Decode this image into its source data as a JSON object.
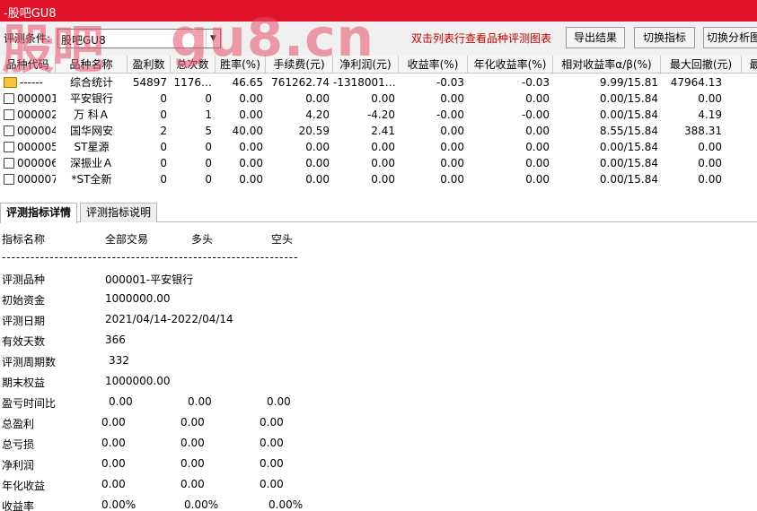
{
  "window": {
    "title": "-股吧GU8"
  },
  "watermark": {
    "left": "股吧",
    "right": "gu8.cn"
  },
  "toolbar": {
    "condition_label": "评测条件:",
    "condition_value": "股吧GU8",
    "hint": "双击列表行查看品种评测图表",
    "export_label": "导出结果",
    "switch_indicator_label": "切换指标",
    "switch_analysis_label": "切换分析图"
  },
  "table": {
    "columns": [
      "品种代码",
      "品种名称",
      "盈利数",
      "总次数",
      "胜率(%)",
      "手续费(元)",
      "净利润(元)",
      "收益率(%)",
      "年化收益率(%)",
      "相对收益率α/β(%)",
      "最大回撤(元)",
      "最"
    ],
    "rows": [
      [
        "------",
        "综合统计",
        "54897",
        "1176…",
        "46.65",
        "761262.74",
        "-1318001…",
        "-0.03",
        "-0.03",
        "9.99/15.81",
        "47964.13"
      ],
      [
        "000001",
        "平安银行",
        "0",
        "0",
        "0.00",
        "0.00",
        "0.00",
        "0.00",
        "0.00",
        "0.00/15.84",
        "0.00"
      ],
      [
        "000002",
        "万 科Ａ",
        "0",
        "1",
        "0.00",
        "4.20",
        "-4.20",
        "-0.00",
        "-0.00",
        "0.00/15.84",
        "4.19"
      ],
      [
        "000004",
        "国华网安",
        "2",
        "5",
        "40.00",
        "20.59",
        "2.41",
        "0.00",
        "0.00",
        "8.55/15.84",
        "388.31"
      ],
      [
        "000005",
        "ST星源",
        "0",
        "0",
        "0.00",
        "0.00",
        "0.00",
        "0.00",
        "0.00",
        "0.00/15.84",
        "0.00"
      ],
      [
        "000006",
        "深振业Ａ",
        "0",
        "0",
        "0.00",
        "0.00",
        "0.00",
        "0.00",
        "0.00",
        "0.00/15.84",
        "0.00"
      ],
      [
        "000007",
        "*ST全新",
        "0",
        "0",
        "0.00",
        "0.00",
        "0.00",
        "0.00",
        "0.00",
        "0.00/15.84",
        "0.00"
      ]
    ]
  },
  "tabs": {
    "detail": "评测指标详情",
    "explain": "评测指标说明"
  },
  "detail": {
    "header": {
      "name": "指标名称",
      "all": "全部交易",
      "long": "多头",
      "short": "空头"
    },
    "separator": "--------------------------------------------------------------",
    "info": [
      {
        "label": "评测品种",
        "value": "000001-平安银行"
      },
      {
        "label": "初始资金",
        "value": "1000000.00"
      },
      {
        "label": "评测日期",
        "value": "2021/04/14-2022/04/14"
      },
      {
        "label": "有效天数",
        "value": "366"
      },
      {
        "label": "评测周期数",
        "value": "332"
      },
      {
        "label": "期末权益",
        "value": "1000000.00"
      }
    ],
    "stats": [
      {
        "label": "盈亏时间比",
        "all": "0.00",
        "long": "0.00",
        "short": "0.00"
      },
      {
        "label": "总盈利",
        "all": "0.00",
        "long": "0.00",
        "short": "0.00"
      },
      {
        "label": "总亏损",
        "all": "0.00",
        "long": "0.00",
        "short": "0.00"
      },
      {
        "label": "净利润",
        "all": "0.00",
        "long": "0.00",
        "short": "0.00"
      },
      {
        "label": "年化收益",
        "all": "0.00",
        "long": "0.00",
        "short": "0.00"
      },
      {
        "label": "收益率",
        "all": "0.00%",
        "long": "0.00%",
        "short": "0.00%"
      }
    ]
  }
}
